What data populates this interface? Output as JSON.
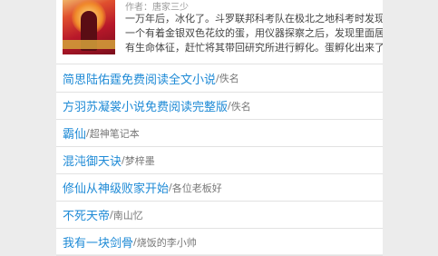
{
  "book": {
    "author_line": "作者：唐家三少",
    "summary_lines": [
      "一万年后，冰化了。斗罗联邦科考队在极北之地科考时发现了",
      "一个有着金银双色花纹的蛋，用仪器探察之后，发现里面居然",
      "有生命体征，赶忙将其带回研究所进行孵化。蛋孵化出来了，"
    ]
  },
  "related": [
    {
      "title": "简思陆佑霆免费阅读全文小说",
      "author": "佚名"
    },
    {
      "title": "方羽苏凝裳小说免费阅读完整版",
      "author": "佚名"
    },
    {
      "title": "霸仙",
      "author": "超神笔记本"
    },
    {
      "title": "混沌御天诀",
      "author": "梦梓墨"
    },
    {
      "title": "修仙从神级败家开始",
      "author": "各位老板好"
    },
    {
      "title": "不死天帝",
      "author": "南山忆"
    },
    {
      "title": "我有一块剑骨",
      "author": "烧饭的李小帅"
    }
  ],
  "separator": "/"
}
